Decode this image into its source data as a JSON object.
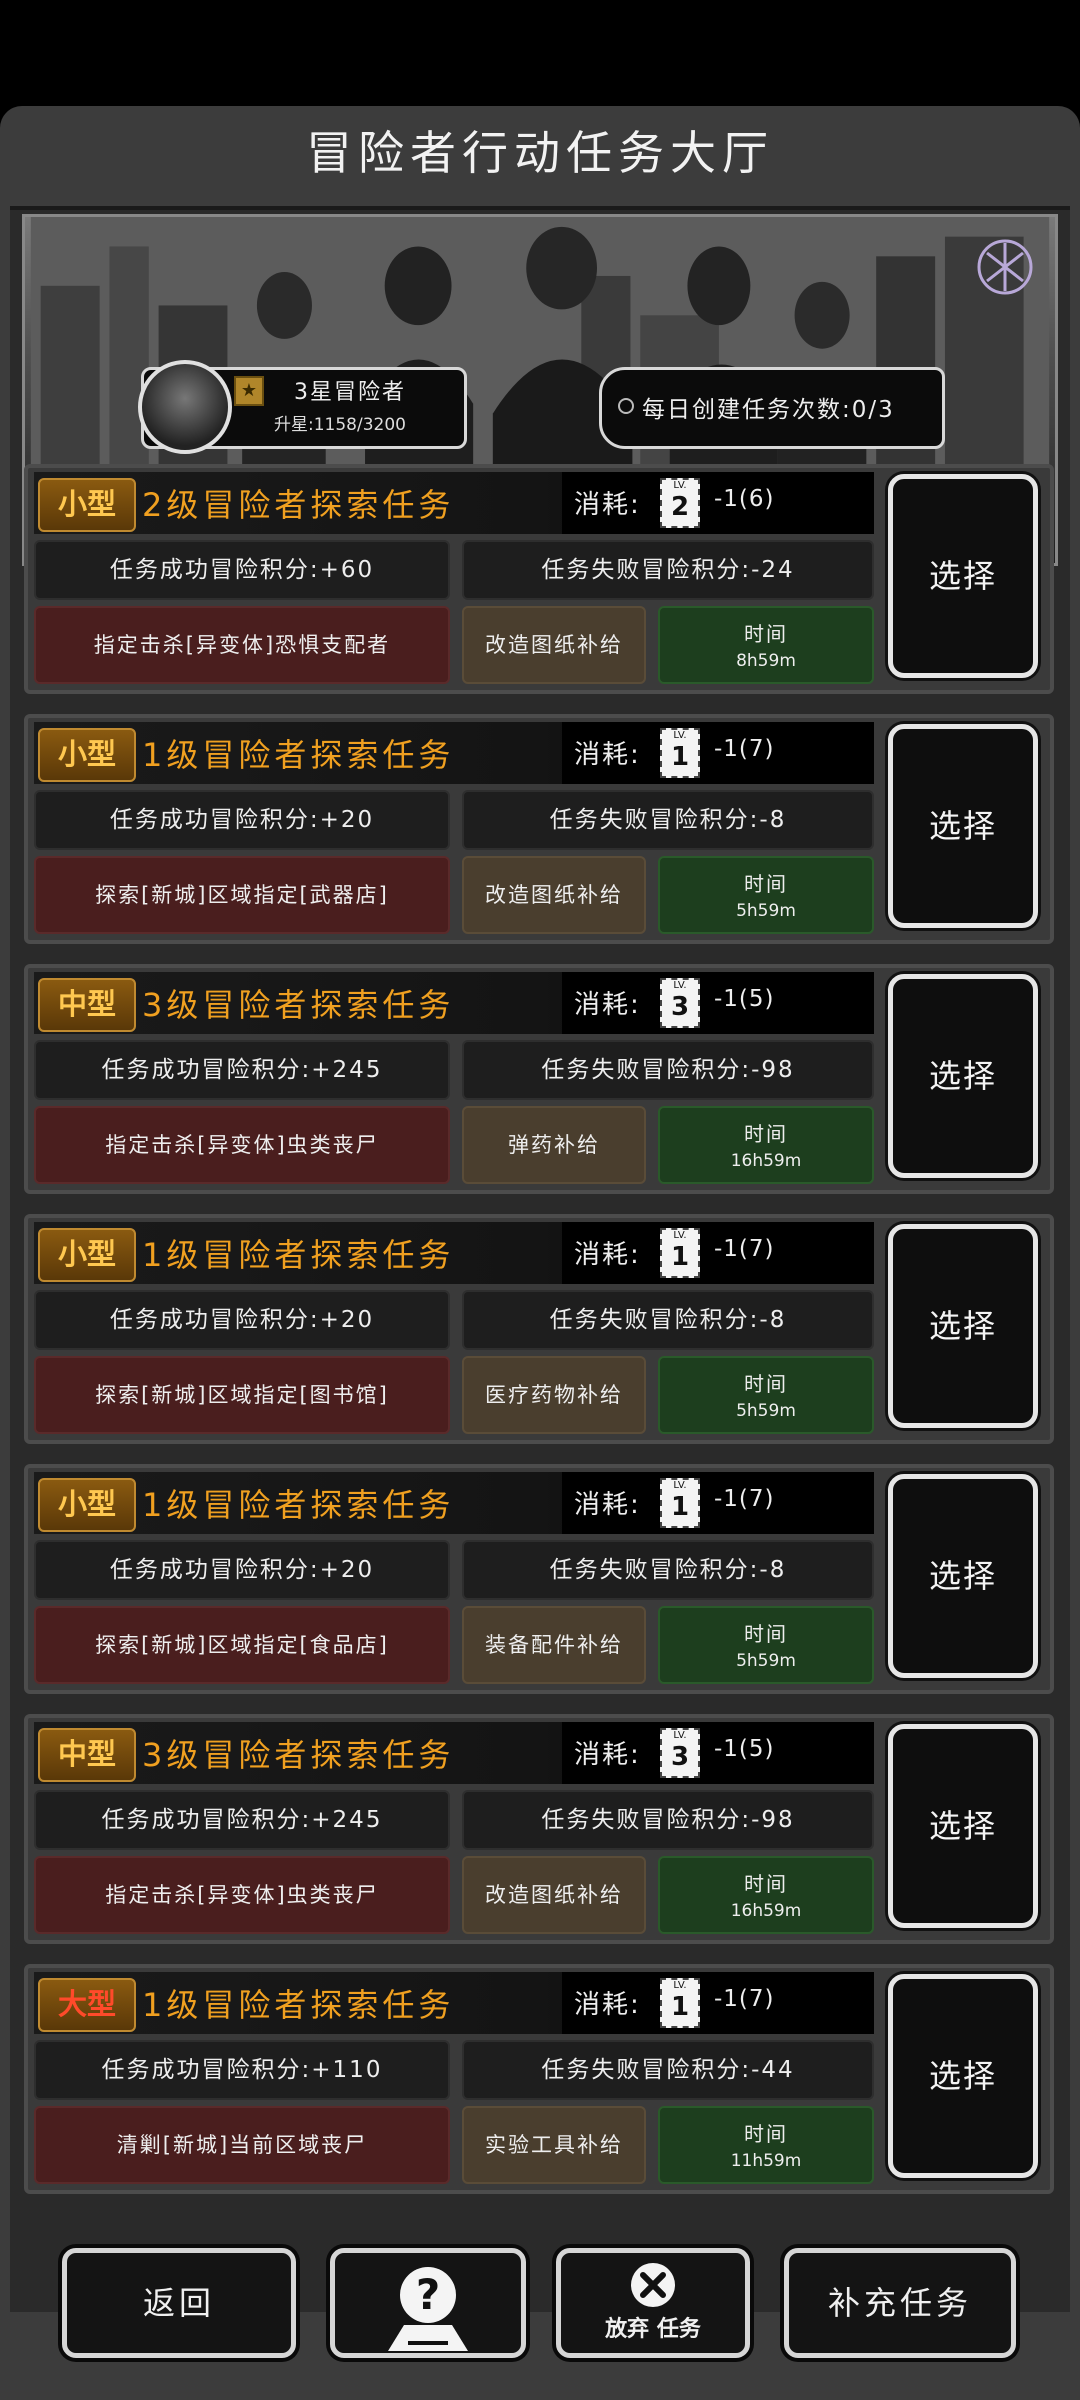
{
  "header": {
    "title": "冒险者行动任务大厅"
  },
  "banner": {
    "rank_title": "3星冒险者",
    "rank_progress": "升星:1158/3200",
    "daily_text": "每日创建任务次数:0/3"
  },
  "labels": {
    "cost": "消耗:",
    "time": "时间",
    "select": "选择"
  },
  "tasks": [
    {
      "size": "小型",
      "name": "2级冒险者探索任务",
      "lv": "2",
      "cost": "-1(6)",
      "success": "任务成功冒险积分:+60",
      "fail": "任务失败冒险积分:-24",
      "target": "指定击杀[异变体]恐惧支配者",
      "supply": "改造图纸补给",
      "time": "8h59m"
    },
    {
      "size": "小型",
      "name": "1级冒险者探索任务",
      "lv": "1",
      "cost": "-1(7)",
      "success": "任务成功冒险积分:+20",
      "fail": "任务失败冒险积分:-8",
      "target": "探索[新城]区域指定[武器店]",
      "supply": "改造图纸补给",
      "time": "5h59m"
    },
    {
      "size": "中型",
      "name": "3级冒险者探索任务",
      "lv": "3",
      "cost": "-1(5)",
      "success": "任务成功冒险积分:+245",
      "fail": "任务失败冒险积分:-98",
      "target": "指定击杀[异变体]虫类丧尸",
      "supply": "弹药补给",
      "time": "16h59m"
    },
    {
      "size": "小型",
      "name": "1级冒险者探索任务",
      "lv": "1",
      "cost": "-1(7)",
      "success": "任务成功冒险积分:+20",
      "fail": "任务失败冒险积分:-8",
      "target": "探索[新城]区域指定[图书馆]",
      "supply": "医疗药物补给",
      "time": "5h59m"
    },
    {
      "size": "小型",
      "name": "1级冒险者探索任务",
      "lv": "1",
      "cost": "-1(7)",
      "success": "任务成功冒险积分:+20",
      "fail": "任务失败冒险积分:-8",
      "target": "探索[新城]区域指定[食品店]",
      "supply": "装备配件补给",
      "time": "5h59m"
    },
    {
      "size": "中型",
      "name": "3级冒险者探索任务",
      "lv": "3",
      "cost": "-1(5)",
      "success": "任务成功冒险积分:+245",
      "fail": "任务失败冒险积分:-98",
      "target": "指定击杀[异变体]虫类丧尸",
      "supply": "改造图纸补给",
      "time": "16h59m"
    },
    {
      "size": "大型",
      "name": "1级冒险者探索任务",
      "lv": "1",
      "cost": "-1(7)",
      "success": "任务成功冒险积分:+110",
      "fail": "任务失败冒险积分:-44",
      "target": "清剿[新城]当前区域丧尸",
      "supply": "实验工具补给",
      "time": "11h59m"
    }
  ],
  "footer": {
    "back": "返回",
    "abandon": "放弃 任务",
    "refill": "补充任务",
    "help_icon": "question-icon",
    "abandon_icon": "close-icon"
  }
}
